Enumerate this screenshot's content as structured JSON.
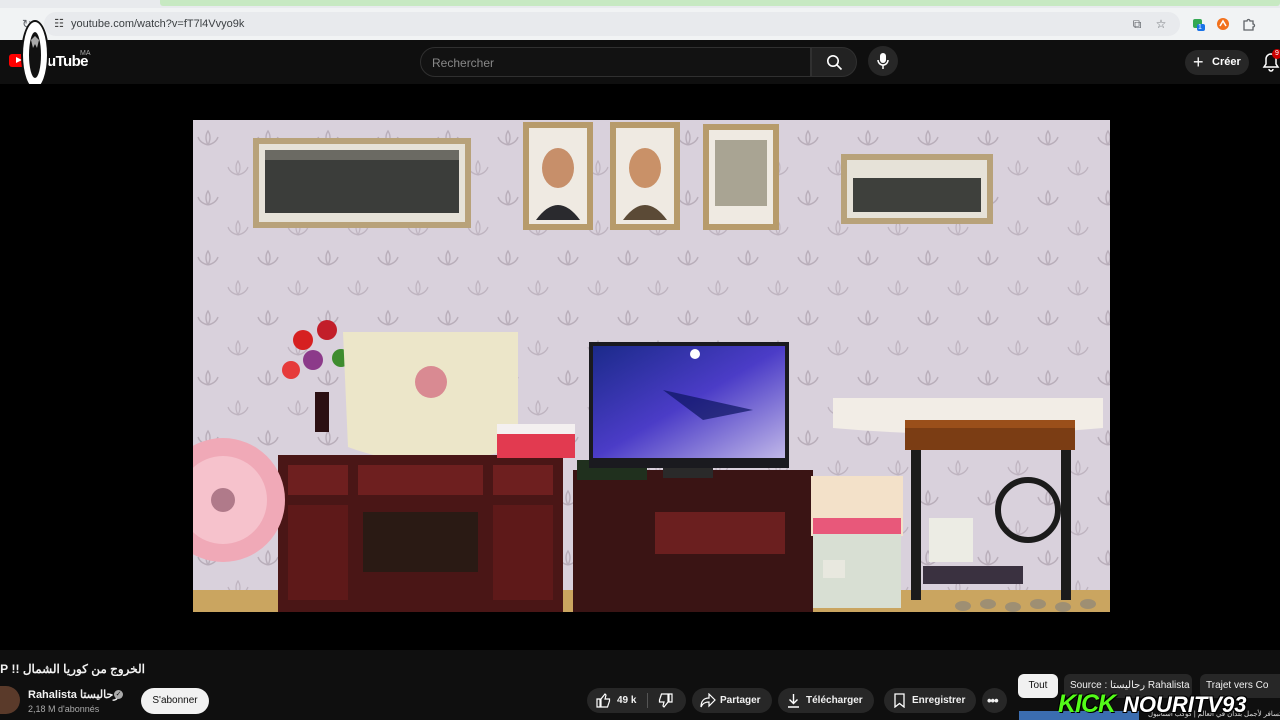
{
  "browser": {
    "url": "youtube.com/watch?v=fT7l4Vvyo9k",
    "tab_badge_count": "1"
  },
  "header": {
    "logo_text": "uTube",
    "region": "MA",
    "search_placeholder": "Rechercher",
    "create_label": "Créer",
    "notification_count": "9"
  },
  "video": {
    "title": "الخروج من كوريا الشمال !! KP",
    "channel": {
      "name": "Rahalista رحاليستا",
      "subscribers": "2,18 M d'abonnés",
      "subscribe_label": "S'abonner"
    },
    "actions": {
      "likes": "49 k",
      "share_label": "Partager",
      "download_label": "Télécharger",
      "save_label": "Enregistrer"
    }
  },
  "chips": {
    "all": "Tout",
    "source": "Source : رحاليستا Rahalista",
    "route": "Trajet vers Co"
  },
  "watermark": {
    "kick": "KICK",
    "name": "NOURITV93"
  },
  "peek_text": "تسافر لأجمل بلدان في العالم | كوكب استانبول"
}
